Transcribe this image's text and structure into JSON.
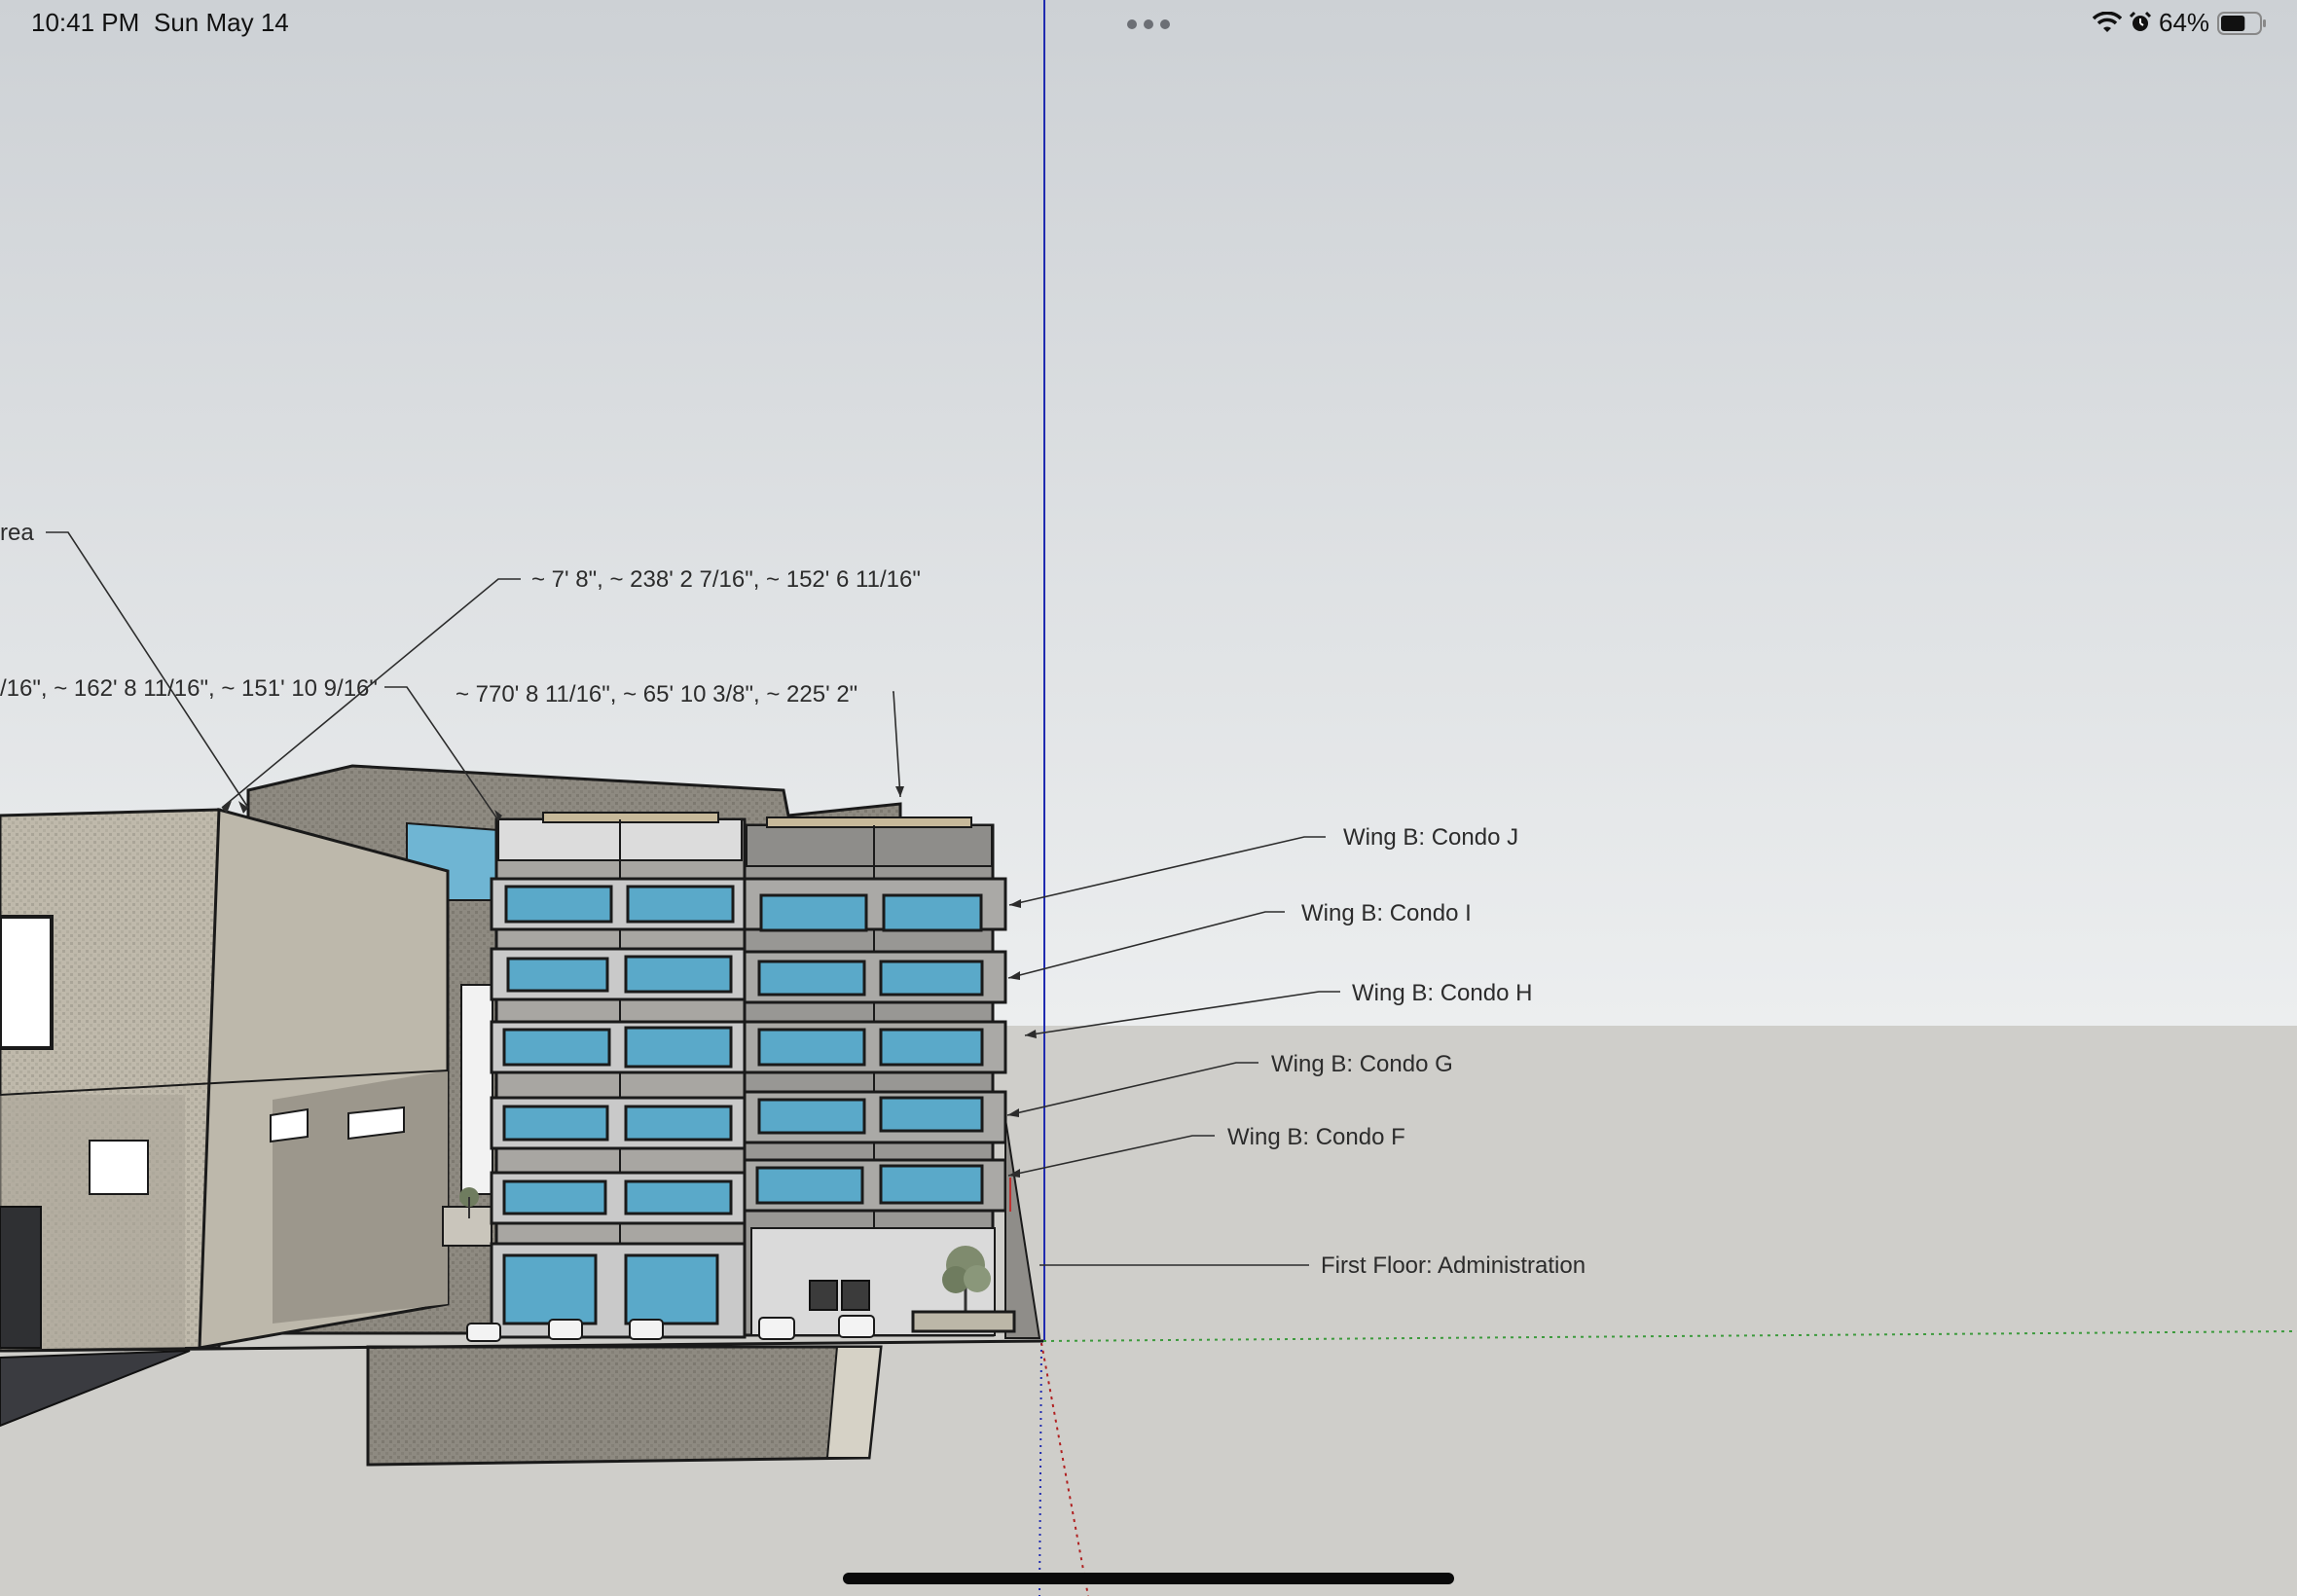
{
  "status_bar": {
    "time": "10:41 PM",
    "date": "Sun May 14",
    "battery_percent": "64%",
    "battery_level": 0.64,
    "icons": [
      "wifi-icon",
      "alarm-icon",
      "battery-icon"
    ]
  },
  "multitasking": {
    "icon": "ellipsis-icon"
  },
  "model": {
    "background_colors": {
      "sky_top": "#cdd1d5",
      "sky_bottom": "#eceeef",
      "ground": "#cfceca",
      "glass": "#5aa9c9"
    },
    "annotations": {
      "area_partial": "rea",
      "coords_1": "~ 7' 8\", ~ 238' 2 7/16\", ~ 152' 6 11/16\"",
      "coords_2": "/16\", ~ 162' 8 11/16\", ~ 151' 10 9/16\"",
      "coords_3": "~ 770' 8 11/16\", ~ 65' 10 3/8\", ~ 225' 2\"",
      "condo_j": "Wing B: Condo J",
      "condo_i": "Wing B: Condo I",
      "condo_h": "Wing B: Condo H",
      "condo_g": "Wing B: Condo G",
      "condo_f": "Wing B: Condo F",
      "first_floor": "First Floor: Administration"
    }
  }
}
